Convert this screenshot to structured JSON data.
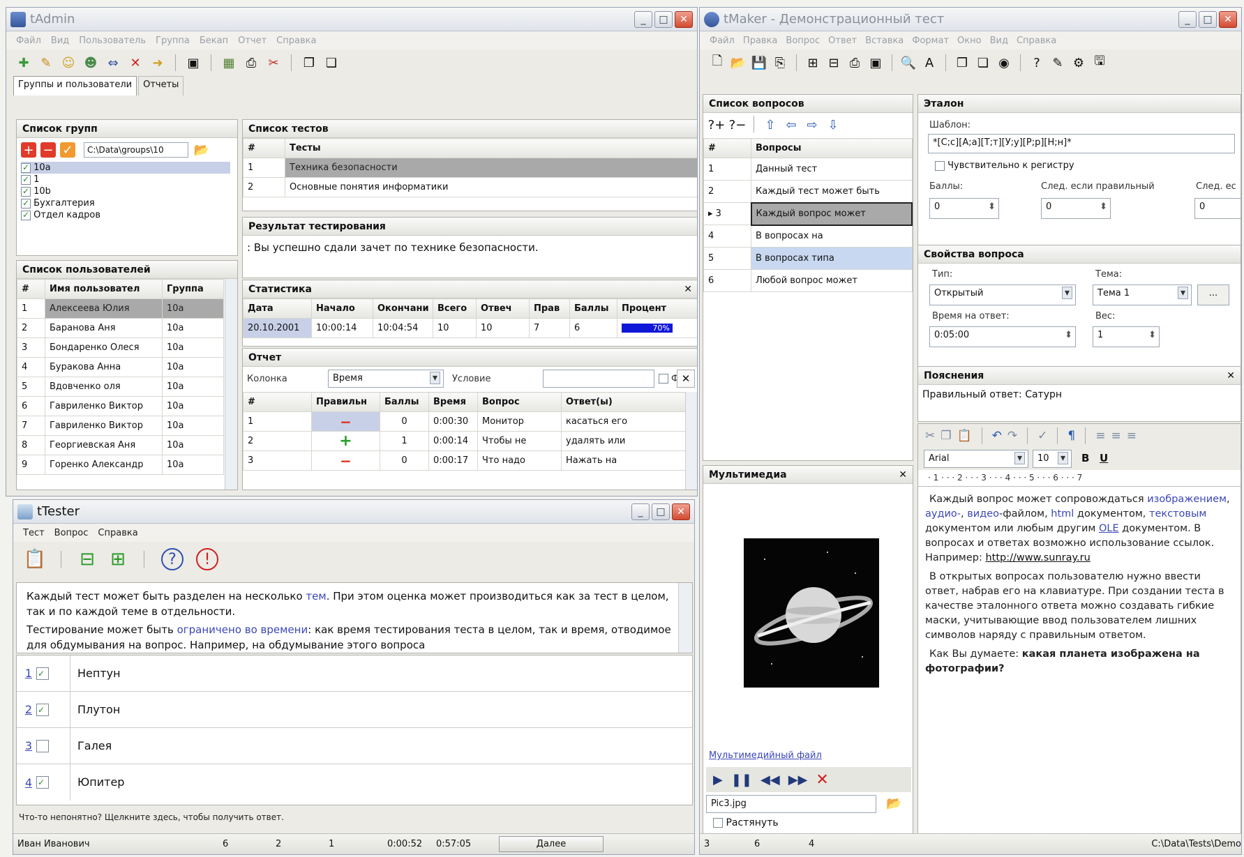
{
  "admin": {
    "title": "tAdmin",
    "menu": [
      "Файл",
      "Вид",
      "Пользователь",
      "Группа",
      "Бекап",
      "Отчет",
      "Справка"
    ],
    "tabs": [
      "Группы и пользователи",
      "Отчеты"
    ],
    "groups_head": "Список групп",
    "groups_path": "C:\\Data\\groups\\10",
    "groups": [
      "10a",
      "1",
      "10b",
      "Бухгалтерия",
      "Отдел кадров"
    ],
    "users_head": "Список пользователей",
    "users_cols": [
      "#",
      "Имя пользовател",
      "Группа"
    ],
    "users": [
      {
        "n": "1",
        "name": "Алексеева Юлия",
        "group": "10а"
      },
      {
        "n": "2",
        "name": "Баранова Аня",
        "group": "10а"
      },
      {
        "n": "3",
        "name": "Бондаренко Олеся",
        "group": "10а"
      },
      {
        "n": "4",
        "name": "Буракова Анна",
        "group": "10а"
      },
      {
        "n": "5",
        "name": "Вдовченко оля",
        "group": "10а"
      },
      {
        "n": "6",
        "name": "Гавриленко Виктор",
        "group": "10а"
      },
      {
        "n": "7",
        "name": "Гавриленко Виктор",
        "group": "10а"
      },
      {
        "n": "8",
        "name": "Георгиевская Аня",
        "group": "10а"
      },
      {
        "n": "9",
        "name": "Горенко Александр",
        "group": "10а"
      }
    ],
    "tests_head": "Список тестов",
    "tests_cols": [
      "#",
      "Тесты"
    ],
    "tests": [
      {
        "n": "1",
        "name": "Техника безопасности"
      },
      {
        "n": "2",
        "name": "Основные понятия информатики"
      }
    ],
    "result_head": "Результат тестирования",
    "result_text": ": Вы успешно сдали зачет по технике безопасности.",
    "stats_head": "Статистика",
    "stats_cols": [
      "Дата",
      "Начало",
      "Окончани",
      "Всего",
      "Отвеч",
      "Прав",
      "Баллы",
      "Процент"
    ],
    "stats_row": [
      "20.10.2001",
      "10:00:14",
      "10:04:54",
      "10",
      "10",
      "7",
      "6",
      "70%"
    ],
    "report_head": "Отчет",
    "report_col_label": "Колонка",
    "report_col_value": "Время",
    "report_cond_label": "Условие",
    "report_extra": "Ф",
    "report_cols": [
      "#",
      "Правильн",
      "Баллы",
      "Время",
      "Вопрос",
      "Ответ(ы)"
    ],
    "report_rows": [
      {
        "n": "1",
        "ok": "−",
        "score": "0",
        "time": "0:00:30",
        "q": "Монитор",
        "a": "касаться его"
      },
      {
        "n": "2",
        "ok": "+",
        "score": "1",
        "time": "0:00:14",
        "q": "Чтобы не",
        "a": "удалять или"
      },
      {
        "n": "3",
        "ok": "−",
        "score": "0",
        "time": "0:00:17",
        "q": "Что надо",
        "a": "Нажать на"
      }
    ]
  },
  "tester": {
    "title": "tTester",
    "menu": [
      "Тест",
      "Вопрос",
      "Справка"
    ],
    "text_p1_a": "Каждый тест может быть разделен на несколько ",
    "text_p1_link": "тем",
    "text_p1_b": ". При этом оценка может производиться как за тест в целом, так и по каждой теме в отдельности.",
    "text_p2_a": "Тестирование может быть ",
    "text_p2_link": "ограничено во времени",
    "text_p2_b": ": как время тестирования теста в целом, так и время, отводимое для обдумывания на вопрос. Например, на обдумывание этого вопроса",
    "answers": [
      {
        "n": "1",
        "checked": true,
        "label": "Нептун"
      },
      {
        "n": "2",
        "checked": true,
        "label": "Плутон"
      },
      {
        "n": "3",
        "checked": false,
        "label": "Галея"
      },
      {
        "n": "4",
        "checked": true,
        "label": "Юпитер"
      }
    ],
    "hint": "Что-то непонятно? Щелкните здесь, чтобы получить ответ.",
    "status": {
      "user": "Иван Иванович",
      "a": "6",
      "b": "2",
      "c": "1",
      "elapsed": "0:00:52",
      "left": "0:57:05",
      "next": "Далее"
    }
  },
  "maker": {
    "title": "tMaker - Демонстрационный тест",
    "menu": [
      "Файл",
      "Правка",
      "Вопрос",
      "Ответ",
      "Вставка",
      "Формат",
      "Окно",
      "Вид",
      "Справка"
    ],
    "questions_head": "Список вопросов",
    "questions_cols": [
      "#",
      "Вопросы"
    ],
    "questions": [
      {
        "n": "1",
        "text": "Данный тест"
      },
      {
        "n": "2",
        "text": "Каждый тест может быть"
      },
      {
        "n": "3",
        "text": "Каждый вопрос может"
      },
      {
        "n": "4",
        "text": "В вопросах на"
      },
      {
        "n": "5",
        "text": "В вопросах типа"
      },
      {
        "n": "6",
        "text": "Любой вопрос может"
      }
    ],
    "etalon_head": "Эталон",
    "template_label": "Шаблон:",
    "template_value": "*[С;с][А;а][Т;т][У;у][Р;р][Н;н]*",
    "case_label": "Чувствительно к регистру",
    "score_label": "Баллы:",
    "score_value": "0",
    "next_ok_label": "След. если правильный",
    "next_ok_value": "0",
    "next_bad_label": "След. ес",
    "next_bad_value": "0",
    "props_head": "Свойства вопроса",
    "type_label": "Тип:",
    "type_value": "Открытый",
    "theme_label": "Тема:",
    "theme_value": "Тема 1",
    "theme_more": "...",
    "time_label": "Время на ответ:",
    "time_value": "0:05:00",
    "weight_label": "Вес:",
    "weight_value": "1",
    "expl_head": "Пояснения",
    "expl_text": "Правильный ответ: Сатурн",
    "font_name": "Arial",
    "font_size": "10",
    "ruler": "· 1 · · · 2 · · · 3 · · · 4 · · · 5 · · · 6 · · · 7",
    "media_head": "Мультимедиа",
    "media_file_label": "Мультимедийный файл",
    "media_file": "Pic3.jpg",
    "stretch_label": "Растянуть",
    "doc": {
      "p1_a": "Каждый вопрос может сопровождаться ",
      "p1_l1": "изображением",
      "p1_sep1": ", ",
      "p1_l2": "аудио-",
      "p1_sep2": ", ",
      "p1_l3": "видео",
      "p1_b": "-файлом, ",
      "p1_l4": "html",
      "p1_c": " документом, ",
      "p1_l5": "текстовым",
      "p1_d": " документом или любым другим ",
      "p1_l6": "OLE",
      "p1_e": " документом. В вопросах и ответах возможно использование ссылок. Например: ",
      "p1_url": "http://www.sunray.ru",
      "p2": "В открытых вопросах пользователю нужно ввести ответ, набрав его на клавиатуре. При создании теста в качестве эталонного ответа можно создавать гибкие маски, учитывающие ввод пользователем лишних символов наряду с правильным ответом.",
      "p3_a": "Как Вы думаете: ",
      "p3_b": "какая планета изображена на фотографии?"
    },
    "status": {
      "a": "3",
      "b": "6",
      "c": "4",
      "path": "C:\\Data\\Tests\\Demo"
    }
  }
}
